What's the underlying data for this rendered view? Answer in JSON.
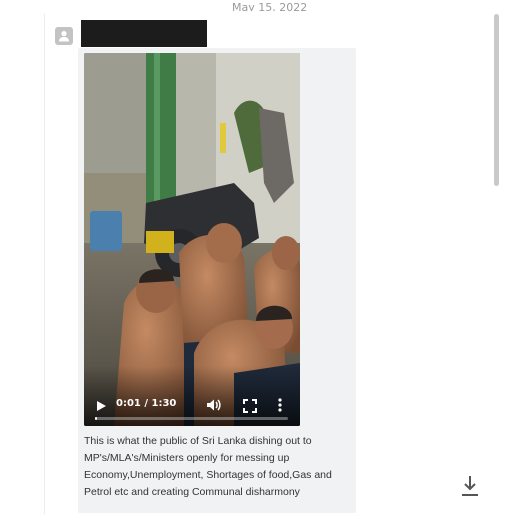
{
  "post": {
    "date": "May 15, 2022",
    "video": {
      "time_display": "0:01 / 1:30",
      "progress_fraction": 0.011
    },
    "caption": "This is what the public of Sri Lanka dishing out to MP's/MLA's/Ministers openly for messing up Economy,Unemployment, Shortages of food,Gas and Petrol etc and creating Communal disharmony"
  },
  "icons": {
    "avatar": "person-icon",
    "play": "play-icon",
    "volume": "volume-icon",
    "fullscreen": "fullscreen-icon",
    "more": "more-vertical-icon",
    "download": "download-icon"
  },
  "colors": {
    "card_background": "#f1f2f3",
    "redaction": "#1c1c1c",
    "scrollbar": "#c9c9c9"
  }
}
